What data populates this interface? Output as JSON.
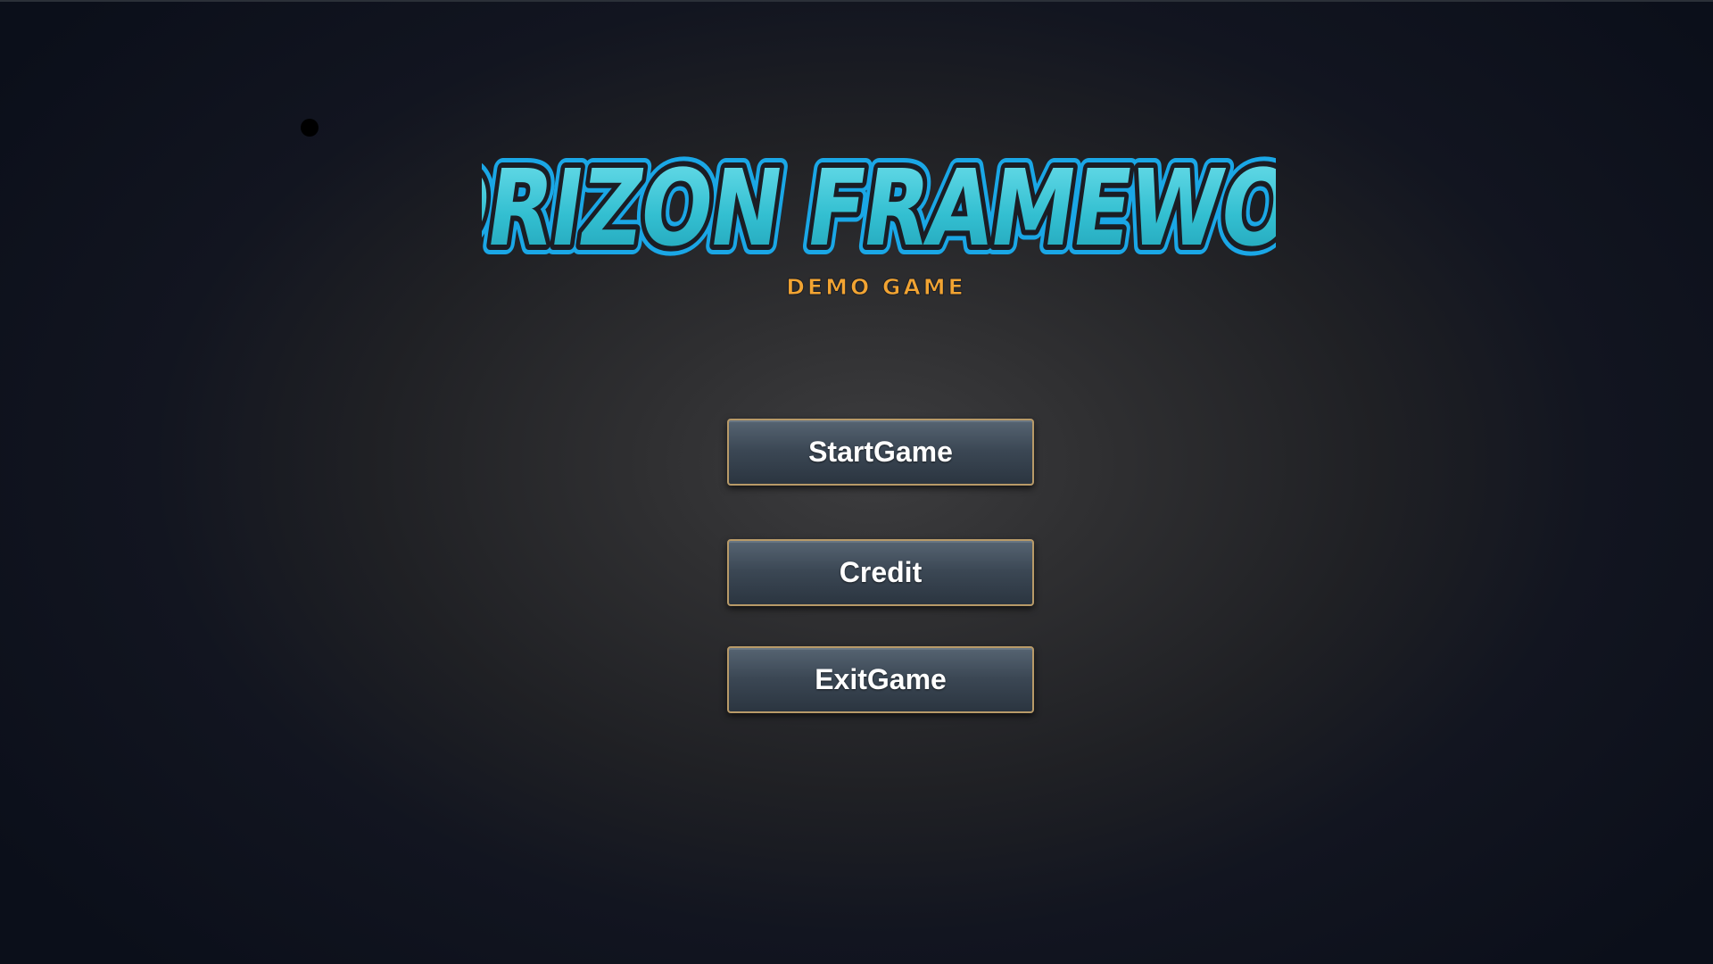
{
  "logo": {
    "title": "HORIZON FRAMEWORK",
    "subtitle": "DEMO GAME",
    "title_fill_color": "#3fc6d6",
    "title_outline_color": "#1b1d24",
    "title_glow_color": "#1aa7e6",
    "subtitle_color": "#f2a432"
  },
  "menu": {
    "start_label": "StartGame",
    "credit_label": "Credit",
    "exit_label": "ExitGame",
    "button_border_color": "#b89a68"
  }
}
